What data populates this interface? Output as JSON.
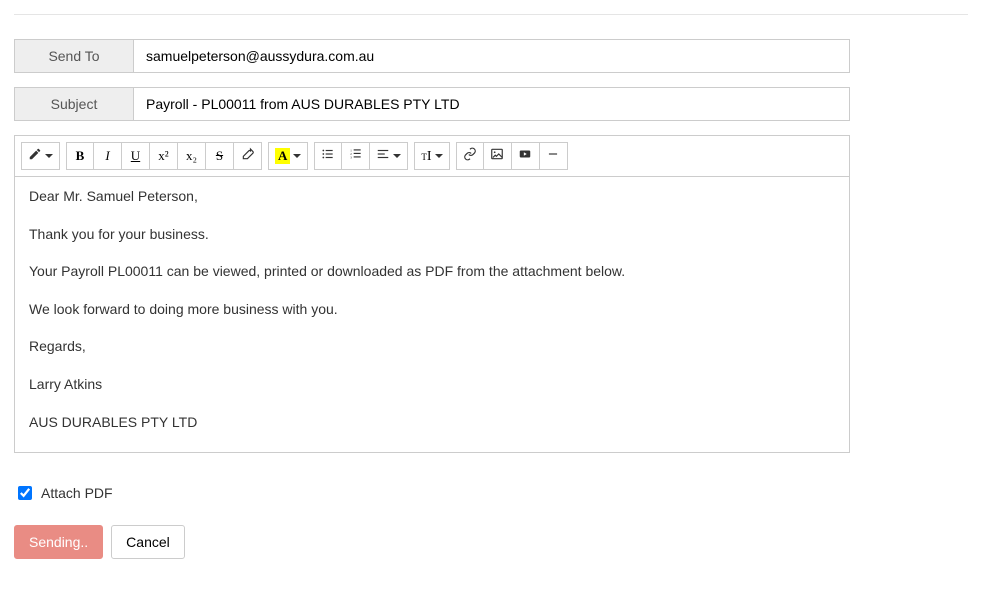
{
  "fields": {
    "sendTo": {
      "label": "Send To",
      "value": "samuelpeterson@aussydura.com.au"
    },
    "subject": {
      "label": "Subject",
      "value": "Payroll - PL00011 from AUS DURABLES PTY LTD"
    }
  },
  "toolbar": {
    "pen": "pen-icon",
    "bold": "B",
    "italic": "I",
    "underline": "U",
    "sup": "x²",
    "sub": "x₂",
    "strike": "S",
    "eraser": "eraser-icon",
    "fontcolor": "A",
    "ul": "list-ul-icon",
    "ol": "list-ol-icon",
    "align": "align-icon",
    "textsize": "tI",
    "link": "link-icon",
    "picture": "picture-icon",
    "video": "video-icon",
    "hr": "minus-icon"
  },
  "body": {
    "line1": "Dear Mr. Samuel Peterson,",
    "line2": "Thank you for your business.",
    "line3": "Your Payroll PL00011 can be viewed, printed or downloaded as PDF from the attachment below.",
    "line4": "We look forward to doing more business with you.",
    "line5": "Regards,",
    "line6": "Larry Atkins",
    "line7": "AUS DURABLES PTY LTD"
  },
  "attach": {
    "label": "Attach PDF",
    "checked": true
  },
  "actions": {
    "send": "Sending..",
    "cancel": "Cancel"
  }
}
